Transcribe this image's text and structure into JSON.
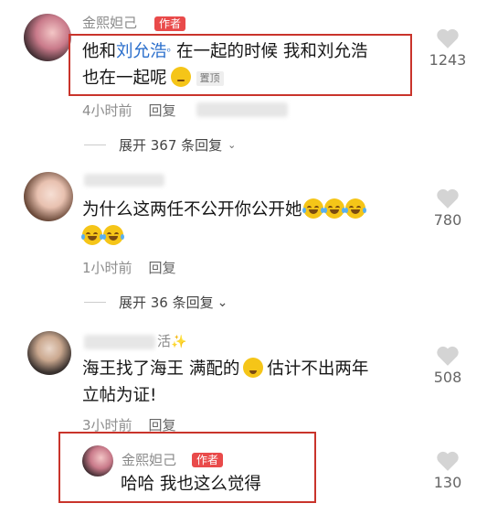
{
  "comments": [
    {
      "author": "金熙妲己",
      "author_tag": "作者",
      "text_prefix": "他和",
      "mention": "刘允浩",
      "text_rest": "在一起的时候 我和刘允浩",
      "text_line2": "也在一起呢",
      "pinned_label": "置顶",
      "time": "4小时前",
      "reply_label": "回复",
      "expand_label": "展开 367 条回复",
      "likes": "1243"
    },
    {
      "text": "为什么这两任不公开你公开她",
      "time": "1小时前",
      "reply_label": "回复",
      "expand_label": "展开 36 条回复",
      "likes": "780"
    },
    {
      "name_suffix": "活",
      "text_line1": "海王找了海王 满配的",
      "text_line1b": "估计不出两年",
      "text_line2": "立帖为证!",
      "time": "3小时前",
      "reply_label": "回复",
      "likes": "508"
    },
    {
      "author": "金熙妲己",
      "author_tag": "作者",
      "text": "哈哈 我也这么觉得",
      "likes": "130"
    }
  ],
  "icons": {
    "like": "heart-icon",
    "expand": "chevron-down-icon",
    "sparkle": "sparkle-icon"
  },
  "colors": {
    "author_tag": "#e94a4a",
    "highlight_box": "#c9342b",
    "mention": "#2b6fcc"
  }
}
